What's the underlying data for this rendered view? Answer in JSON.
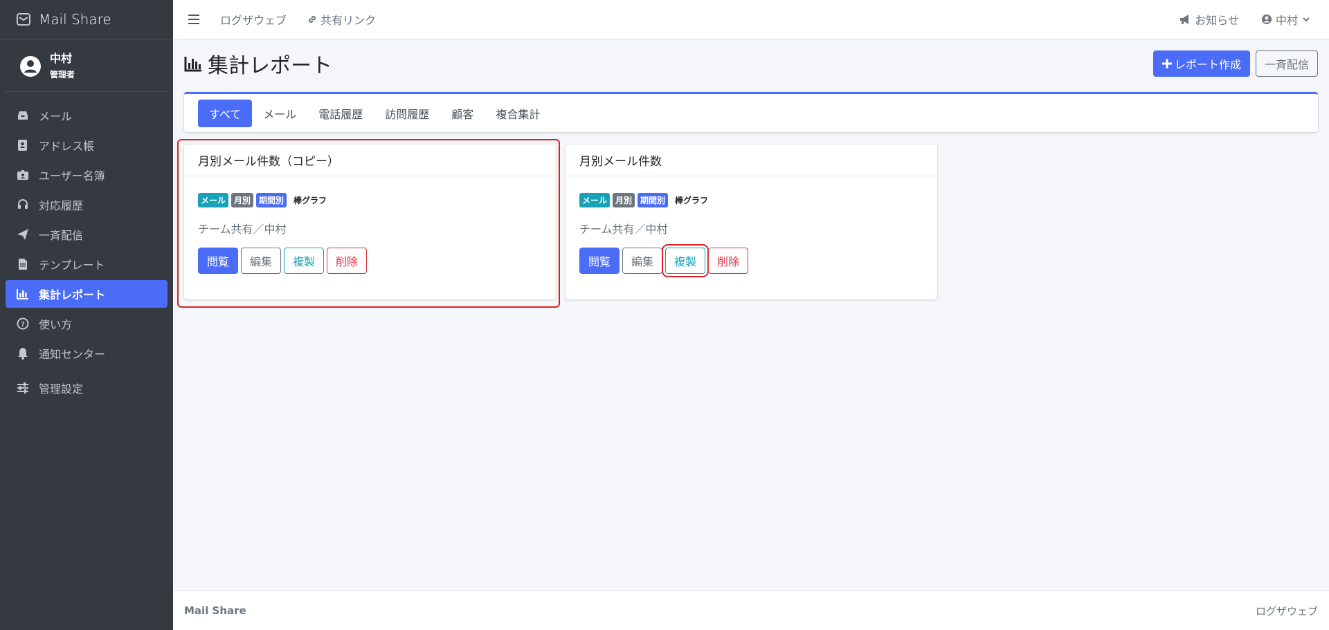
{
  "brand": {
    "name": "Mail Share"
  },
  "user": {
    "name": "中村",
    "role": "管理者"
  },
  "sidebar": {
    "items": [
      {
        "label": "メール",
        "icon": "inbox-icon",
        "active": false
      },
      {
        "label": "アドレス帳",
        "icon": "address-book-icon",
        "active": false
      },
      {
        "label": "ユーザー名簿",
        "icon": "id-badge-icon",
        "active": false
      },
      {
        "label": "対応履歴",
        "icon": "headset-icon",
        "active": false
      },
      {
        "label": "一斉配信",
        "icon": "paper-plane-icon",
        "active": false
      },
      {
        "label": "テンプレート",
        "icon": "file-icon",
        "active": false
      },
      {
        "label": "集計レポート",
        "icon": "chart-bar-icon",
        "active": true
      },
      {
        "label": "使い方",
        "icon": "question-circle-icon",
        "active": false
      },
      {
        "label": "通知センター",
        "icon": "bell-icon",
        "active": false
      },
      {
        "label": "管理設定",
        "icon": "sliders-icon",
        "active": false
      }
    ]
  },
  "topbar": {
    "links": [
      {
        "label": "ログザウェブ"
      },
      {
        "label": "共有リンク"
      }
    ],
    "notice": "お知らせ",
    "user_menu": "中村"
  },
  "page": {
    "title": "集計レポート",
    "create_button": "レポート作成",
    "broadcast_button": "一斉配信"
  },
  "tabs": [
    {
      "label": "すべて",
      "active": true
    },
    {
      "label": "メール",
      "active": false
    },
    {
      "label": "電話履歴",
      "active": false
    },
    {
      "label": "訪問履歴",
      "active": false
    },
    {
      "label": "顧客",
      "active": false
    },
    {
      "label": "複合集計",
      "active": false
    }
  ],
  "reports": [
    {
      "title": "月別メール件数（コピー）",
      "badges": [
        "メール",
        "月別",
        "期間別"
      ],
      "chart_type": "棒グラフ",
      "owner": "チーム共有／中村",
      "actions": {
        "view": "閲覧",
        "edit": "編集",
        "copy": "複製",
        "delete": "削除"
      }
    },
    {
      "title": "月別メール件数",
      "badges": [
        "メール",
        "月別",
        "期間別"
      ],
      "chart_type": "棒グラフ",
      "owner": "チーム共有／中村",
      "actions": {
        "view": "閲覧",
        "edit": "編集",
        "copy": "複製",
        "delete": "削除"
      }
    }
  ],
  "footer": {
    "left": "Mail Share",
    "right": "ログザウェブ"
  },
  "colors": {
    "accent": "#4a6cf7",
    "sidebar_bg": "#343a40",
    "highlight": "#e02020",
    "info": "#17a2b8",
    "danger": "#dc3545"
  }
}
